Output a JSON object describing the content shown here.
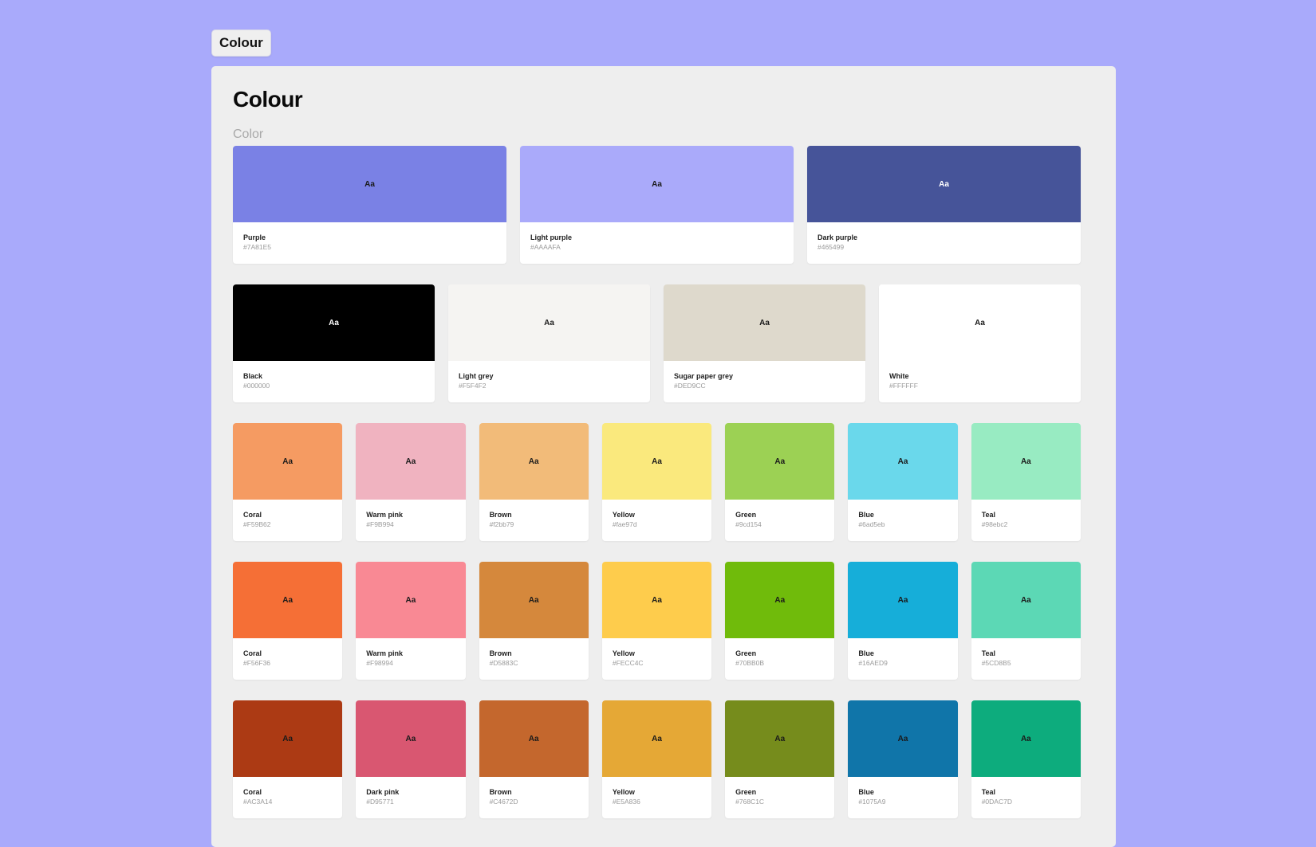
{
  "tab": {
    "label": "Colour"
  },
  "page": {
    "title": "Colour",
    "section_label": "Color"
  },
  "rows": [
    [
      {
        "name": "Purple",
        "hex": "#7A81E5",
        "swatch": "#7A81E5",
        "sample": "Aa",
        "text_color": "#1A1A1A"
      },
      {
        "name": "Light purple",
        "hex": "#AAAAFA",
        "swatch": "#AAAAFA",
        "sample": "Aa",
        "text_color": "#1A1A1A"
      },
      {
        "name": "Dark purple",
        "hex": "#465499",
        "swatch": "#465499",
        "sample": "Aa",
        "text_color": "#FFFFFF"
      }
    ],
    [
      {
        "name": "Black",
        "hex": "#000000",
        "swatch": "#000000",
        "sample": "Aa",
        "text_color": "#FFFFFF"
      },
      {
        "name": "Light grey",
        "hex": "#F5F4F2",
        "swatch": "#F5F4F2",
        "sample": "Aa",
        "text_color": "#1A1A1A"
      },
      {
        "name": "Sugar paper grey",
        "hex": "#DED9CC",
        "swatch": "#DED9CC",
        "sample": "Aa",
        "text_color": "#1A1A1A"
      },
      {
        "name": "White",
        "hex": "#FFFFFF",
        "swatch": "#FFFFFF",
        "sample": "Aa",
        "text_color": "#1A1A1A"
      }
    ],
    [
      {
        "name": "Coral",
        "hex": "#F59B62",
        "swatch": "#F59B62",
        "sample": "Aa",
        "text_color": "#1A1A1A"
      },
      {
        "name": "Warm pink",
        "hex": "#F9B994",
        "swatch": "#F0B3C0",
        "sample": "Aa",
        "text_color": "#1A1A1A"
      },
      {
        "name": "Brown",
        "hex": "#f2bb79",
        "swatch": "#F2BB79",
        "sample": "Aa",
        "text_color": "#1A1A1A"
      },
      {
        "name": "Yellow",
        "hex": "#fae97d",
        "swatch": "#FAE97D",
        "sample": "Aa",
        "text_color": "#1A1A1A"
      },
      {
        "name": "Green",
        "hex": "#9cd154",
        "swatch": "#9CD154",
        "sample": "Aa",
        "text_color": "#1A1A1A"
      },
      {
        "name": "Blue",
        "hex": "#6ad5eb",
        "swatch": "#6AD8EB",
        "sample": "Aa",
        "text_color": "#1A1A1A"
      },
      {
        "name": "Teal",
        "hex": "#98ebc2",
        "swatch": "#98EBC2",
        "sample": "Aa",
        "text_color": "#1A1A1A"
      }
    ],
    [
      {
        "name": "Coral",
        "hex": "#F56F36",
        "swatch": "#F56F36",
        "sample": "Aa",
        "text_color": "#1A1A1A"
      },
      {
        "name": "Warm pink",
        "hex": "#F98994",
        "swatch": "#F98994",
        "sample": "Aa",
        "text_color": "#1A1A1A"
      },
      {
        "name": "Brown",
        "hex": "#D5883C",
        "swatch": "#D5883C",
        "sample": "Aa",
        "text_color": "#1A1A1A"
      },
      {
        "name": "Yellow",
        "hex": "#FECC4C",
        "swatch": "#FECC4C",
        "sample": "Aa",
        "text_color": "#1A1A1A"
      },
      {
        "name": "Green",
        "hex": "#70BB0B",
        "swatch": "#70BB0B",
        "sample": "Aa",
        "text_color": "#1A1A1A"
      },
      {
        "name": "Blue",
        "hex": "#16AED9",
        "swatch": "#16AED9",
        "sample": "Aa",
        "text_color": "#1A1A1A"
      },
      {
        "name": "Teal",
        "hex": "#5CD8B5",
        "swatch": "#5CD8B5",
        "sample": "Aa",
        "text_color": "#1A1A1A"
      }
    ],
    [
      {
        "name": "Coral",
        "hex": "#AC3A14",
        "swatch": "#AC3A14",
        "sample": "Aa",
        "text_color": "#1A1A1A"
      },
      {
        "name": "Dark pink",
        "hex": "#D95771",
        "swatch": "#D95771",
        "sample": "Aa",
        "text_color": "#1A1A1A"
      },
      {
        "name": "Brown",
        "hex": "#C4672D",
        "swatch": "#C4672D",
        "sample": "Aa",
        "text_color": "#1A1A1A"
      },
      {
        "name": "Yellow",
        "hex": "#E5A836",
        "swatch": "#E5A836",
        "sample": "Aa",
        "text_color": "#1A1A1A"
      },
      {
        "name": "Green",
        "hex": "#768C1C",
        "swatch": "#768C1C",
        "sample": "Aa",
        "text_color": "#1A1A1A"
      },
      {
        "name": "Blue",
        "hex": "#1075A9",
        "swatch": "#1075A9",
        "sample": "Aa",
        "text_color": "#1A1A1A"
      },
      {
        "name": "Teal",
        "hex": "#0DAC7D",
        "swatch": "#0DAC7D",
        "sample": "Aa",
        "text_color": "#1A1A1A"
      }
    ]
  ]
}
